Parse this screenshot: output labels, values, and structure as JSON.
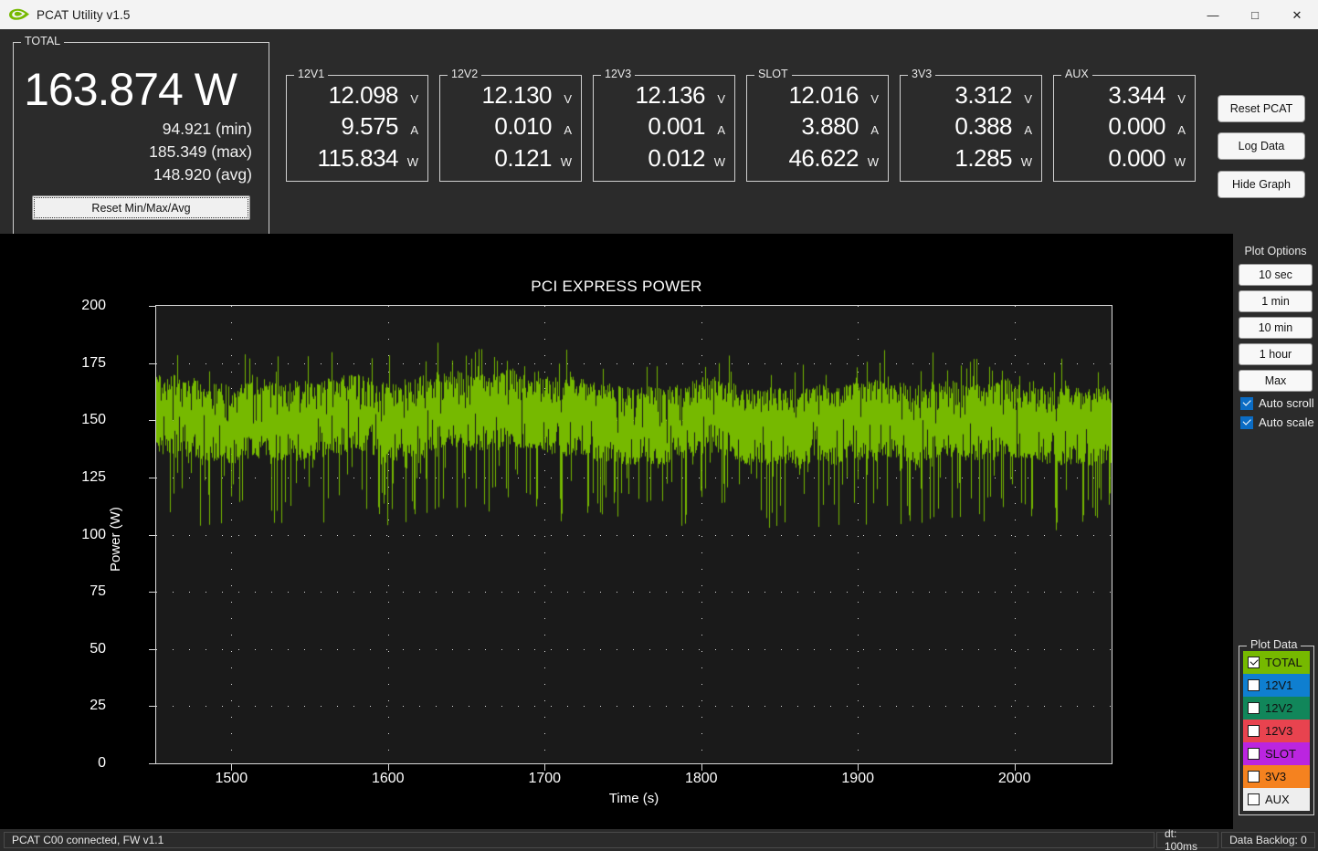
{
  "window": {
    "title": "PCAT Utility v1.5",
    "logo_icon": "nvidia-eye-logo",
    "minimize_icon": "—",
    "maximize_icon": "□",
    "close_icon": "✕"
  },
  "total": {
    "group_label": "TOTAL",
    "value": "163.874 W",
    "min": "94.921",
    "min_label": "(min)",
    "max": "185.349",
    "max_label": "(max)",
    "avg": "148.920",
    "avg_label": "(avg)",
    "reset_button": "Reset Min/Max/Avg"
  },
  "rails": [
    {
      "name": "12V1",
      "v": "12.098",
      "a": "9.575",
      "w": "115.834"
    },
    {
      "name": "12V2",
      "v": "12.130",
      "a": "0.010",
      "w": "0.121"
    },
    {
      "name": "12V3",
      "v": "12.136",
      "a": "0.001",
      "w": "0.012"
    },
    {
      "name": "SLOT",
      "v": "12.016",
      "a": "3.880",
      "w": "46.622"
    },
    {
      "name": "3V3",
      "v": "3.312",
      "a": "0.388",
      "w": "1.285"
    },
    {
      "name": "AUX",
      "v": "3.344",
      "a": "0.000",
      "w": "0.000"
    }
  ],
  "units": {
    "volt": "V",
    "amp": "A",
    "watt": "W"
  },
  "actions": {
    "reset_pcat": "Reset PCAT",
    "log_data": "Log Data",
    "hide_graph": "Hide Graph"
  },
  "plot_options": {
    "header": "Plot Options",
    "ranges": [
      "10 sec",
      "1 min",
      "10 min",
      "1 hour",
      "Max"
    ],
    "auto_scroll": {
      "label": "Auto scroll",
      "checked": true
    },
    "auto_scale": {
      "label": "Auto scale",
      "checked": true
    }
  },
  "plot_data": {
    "group_label": "Plot Data",
    "items": [
      {
        "label": "TOTAL",
        "color": "#76b900",
        "text_color": "#111111",
        "checked": true
      },
      {
        "label": "12V1",
        "color": "#0f7fd0",
        "text_color": "#111111",
        "checked": false
      },
      {
        "label": "12V2",
        "color": "#11865a",
        "text_color": "#111111",
        "checked": false
      },
      {
        "label": "12V3",
        "color": "#e8434f",
        "text_color": "#111111",
        "checked": false
      },
      {
        "label": "SLOT",
        "color": "#bb25e0",
        "text_color": "#111111",
        "checked": false
      },
      {
        "label": "3V3",
        "color": "#f5821f",
        "text_color": "#111111",
        "checked": false
      },
      {
        "label": "AUX",
        "color": "#eeeeee",
        "text_color": "#111111",
        "checked": false
      }
    ]
  },
  "statusbar": {
    "connection": "PCAT C00 connected, FW v1.1",
    "dt": "dt: 100ms",
    "backlog": "Data Backlog: 0"
  },
  "chart_data": {
    "type": "line",
    "title": "PCI EXPRESS POWER",
    "xlabel": "Time (s)",
    "ylabel": "Power (W)",
    "xlim": [
      1452,
      2062
    ],
    "ylim": [
      0,
      200
    ],
    "xticks": [
      1500,
      1600,
      1700,
      1800,
      1900,
      2000
    ],
    "yticks": [
      0,
      25,
      50,
      75,
      100,
      125,
      150,
      175,
      200
    ],
    "grid": "dotted",
    "legend_position": "right-panel",
    "series": [
      {
        "name": "TOTAL",
        "color": "#76b900",
        "units": "W",
        "visible": true,
        "sample_interval_s": 0.1,
        "stats": {
          "min": 94.921,
          "max": 185.349,
          "avg": 148.92,
          "current": 163.874
        },
        "band": {
          "typical_low": 127,
          "typical_high": 176,
          "center": 152
        },
        "note": "Dense high-frequency noise band; occasional downward spikes to ~95 W"
      }
    ]
  }
}
